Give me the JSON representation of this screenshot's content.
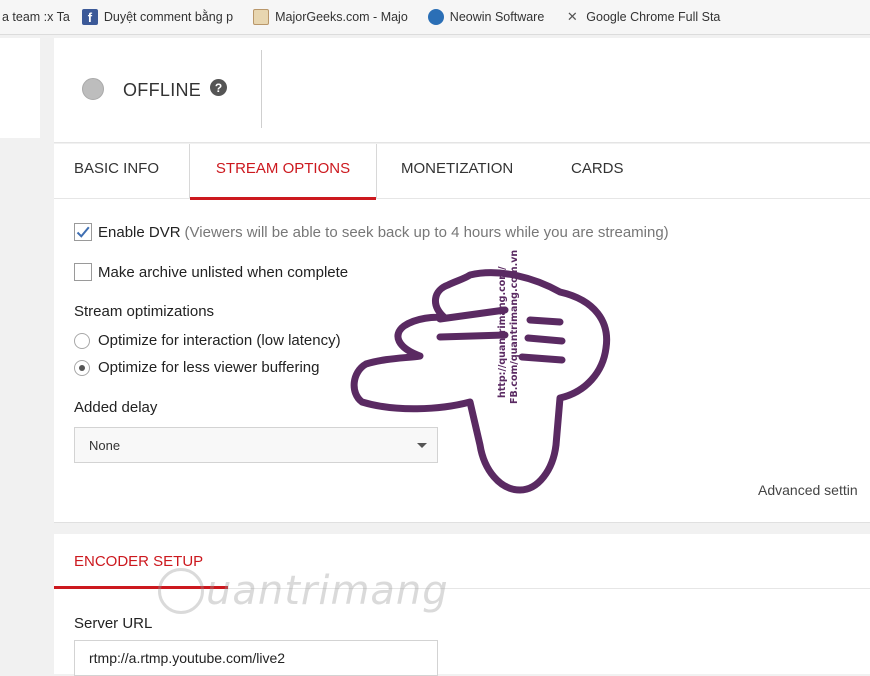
{
  "bookmarks": [
    {
      "label": "a team :x Ta",
      "icon": "none"
    },
    {
      "label": "Duyệt comment bằng p",
      "icon": "facebook-icon"
    },
    {
      "label": "MajorGeeks.com - Majo",
      "icon": "majorgeeks-icon"
    },
    {
      "label": "Neowin Software",
      "icon": "neowin-icon"
    },
    {
      "label": "Google Chrome Full Sta",
      "icon": "chrome-setup-icon"
    }
  ],
  "status": {
    "label": "OFFLINE",
    "help": "?"
  },
  "tabs": [
    {
      "label": "BASIC INFO"
    },
    {
      "label": "STREAM OPTIONS",
      "active": true
    },
    {
      "label": "MONETIZATION"
    },
    {
      "label": "CARDS"
    }
  ],
  "stream_options": {
    "dvr": {
      "label": "Enable DVR",
      "hint": "(Viewers will be able to seek back up to 4 hours while you are streaming)",
      "checked": true
    },
    "archive": {
      "label": "Make archive unlisted when complete",
      "checked": false
    },
    "optimizations_label": "Stream optimizations",
    "optimizations": [
      {
        "label": "Optimize for interaction (low latency)",
        "selected": false
      },
      {
        "label": "Optimize for less viewer buffering",
        "selected": true
      }
    ],
    "delay_label": "Added delay",
    "delay_value": "None",
    "advanced_link": "Advanced settin"
  },
  "encoder": {
    "title": "ENCODER SETUP",
    "server_label": "Server URL",
    "server_value": "rtmp://a.rtmp.youtube.com/live2"
  },
  "overlay": {
    "hand_text_1": "http://quantrimang.com/",
    "hand_text_2": "FB.com/quantrimang.com.vn",
    "watermark": "uantrimang"
  },
  "colors": {
    "accent": "#cc181e",
    "hand": "#5a2a62"
  }
}
